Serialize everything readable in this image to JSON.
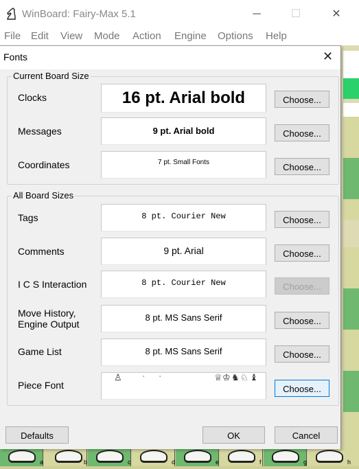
{
  "main_window": {
    "title": "WinBoard: Fairy-Max 5.1",
    "controls": {
      "minimize": "─",
      "maximize": "☐",
      "close": "✕"
    },
    "menu": [
      "File",
      "Edit",
      "View",
      "Mode",
      "Action",
      "Engine",
      "Options",
      "Help"
    ]
  },
  "board": {
    "file_labels": [
      "a",
      "b",
      "c",
      "d",
      "e",
      "f",
      "g",
      "h"
    ]
  },
  "dialog": {
    "title": "Fonts",
    "close": "✕",
    "current_board": {
      "group_title": "Current Board Size",
      "rows": [
        {
          "label": "Clocks",
          "sample": "16 pt. Arial bold",
          "button": "Choose..."
        },
        {
          "label": "Messages",
          "sample": "9 pt. Arial bold",
          "button": "Choose..."
        },
        {
          "label": "Coordinates",
          "sample": "7 pt. Small Fonts",
          "button": "Choose..."
        }
      ]
    },
    "all_boards": {
      "group_title": "All Board Sizes",
      "rows": [
        {
          "label": "Tags",
          "sample": "8 pt. Courier New",
          "button": "Choose..."
        },
        {
          "label": "Comments",
          "sample": "9 pt. Arial",
          "button": "Choose..."
        },
        {
          "label": "I C S Interaction",
          "sample": "8 pt. Courier New",
          "button": "Choose..."
        },
        {
          "label": "Move History,",
          "label2": "Engine Output",
          "sample": "8 pt. MS Sans Serif",
          "button": "Choose..."
        },
        {
          "label": "Game List",
          "sample": "8 pt. MS Sans Serif",
          "button": "Choose..."
        },
        {
          "label": "Piece Font",
          "button": "Choose..."
        }
      ]
    },
    "footer": {
      "defaults": "Defaults",
      "ok": "OK",
      "cancel": "Cancel"
    }
  }
}
